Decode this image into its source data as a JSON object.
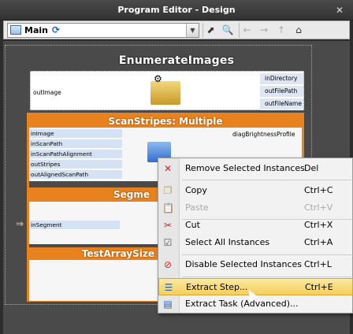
{
  "window": {
    "title": "Program Editor - Design",
    "close_glyph": "✕"
  },
  "toolbar": {
    "selected": "Main"
  },
  "canvas": {
    "enumerate": {
      "title": "EnumerateImages",
      "inputs_left": [
        "outImage"
      ],
      "outputs_right": [
        "inDirectory",
        "outFilePath",
        "outFileName"
      ]
    },
    "scan": {
      "title": "ScanStripes: Multiple",
      "rows": [
        "inImage",
        "inScanPath",
        "inScanPathAlignment",
        "outStripes",
        "outAlignedScanPath"
      ],
      "right": "diagBrightnessProfile"
    },
    "segment": {
      "title": "Segme",
      "rows": [
        "inSegment"
      ]
    },
    "test": {
      "title": "TestArraySize"
    }
  },
  "menu": {
    "items": [
      {
        "label": "Remove Selected Instances",
        "shortcut": "Del",
        "icon": "remove-icon"
      },
      {
        "label": "Copy",
        "shortcut": "Ctrl+C",
        "icon": "copy-icon"
      },
      {
        "label": "Paste",
        "shortcut": "Ctrl+V",
        "icon": "paste-icon"
      },
      {
        "label": "Cut",
        "shortcut": "Ctrl+X",
        "icon": "cut-icon"
      },
      {
        "label": "Select All Instances",
        "shortcut": "Ctrl+A",
        "icon": "select-all-icon"
      },
      {
        "label": "Disable Selected Instances",
        "shortcut": "Ctrl+L",
        "icon": "disable-icon"
      },
      {
        "label": "Extract Step...",
        "shortcut": "Ctrl+E",
        "icon": "extract-step-icon"
      },
      {
        "label": "Extract Task (Advanced)...",
        "shortcut": "",
        "icon": "extract-task-icon"
      }
    ]
  }
}
